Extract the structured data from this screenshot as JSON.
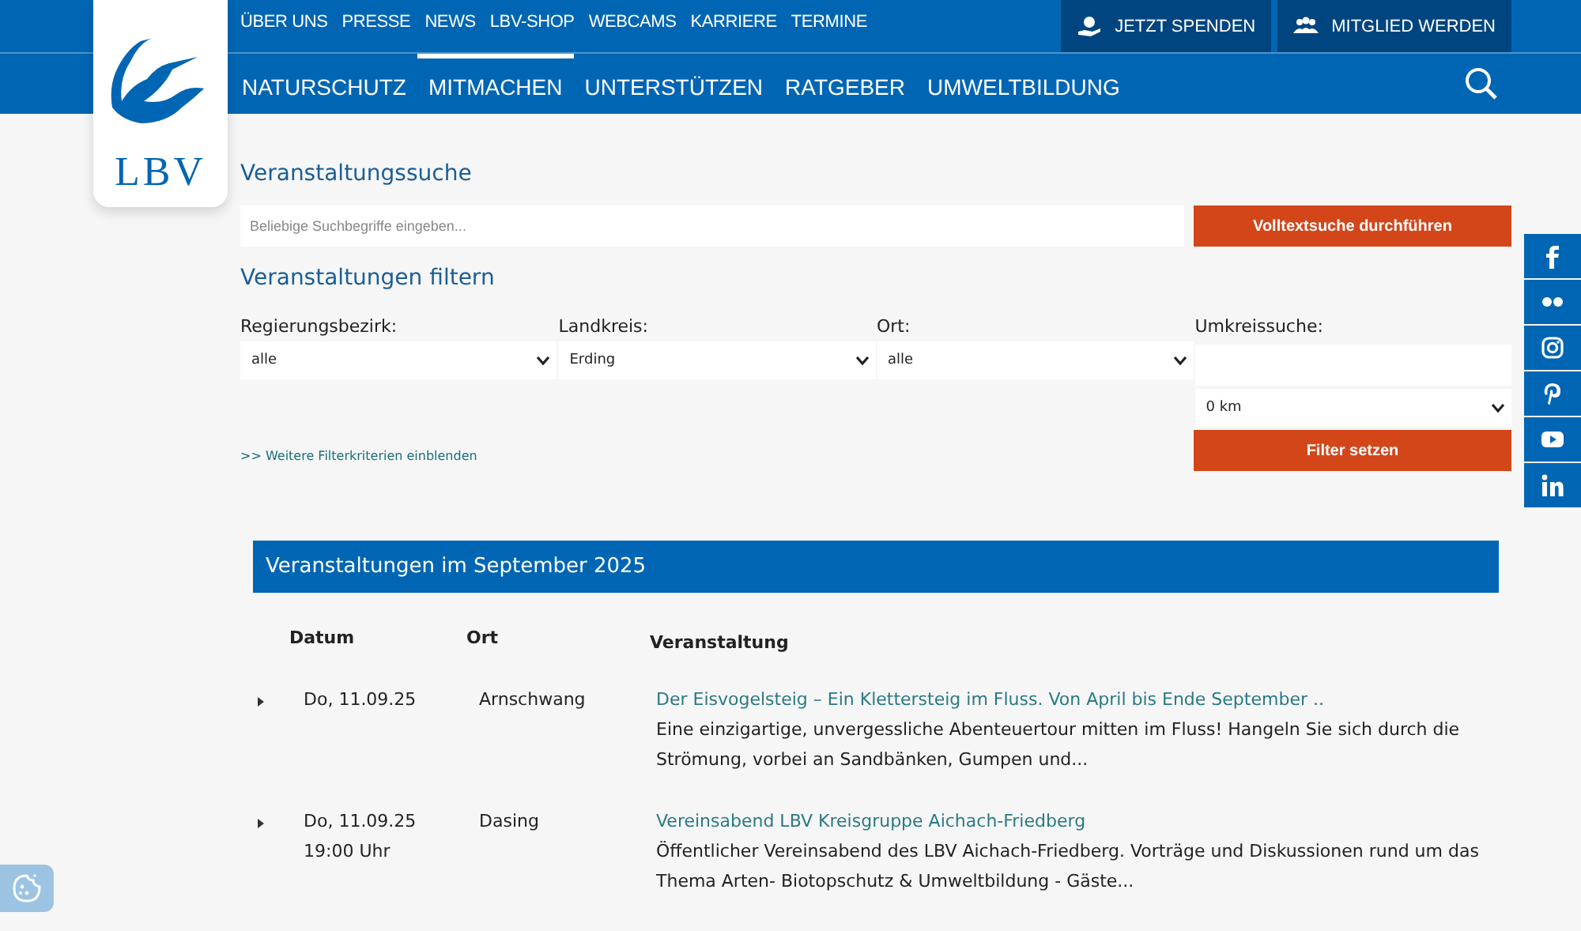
{
  "top_links": [
    {
      "label": "ÜBER UNS"
    },
    {
      "label": "PRESSE"
    },
    {
      "label": "NEWS"
    },
    {
      "label": "LBV-SHOP"
    },
    {
      "label": "WEBCAMS"
    },
    {
      "label": "KARRIERE"
    },
    {
      "label": "TERMINE"
    }
  ],
  "action_buttons": [
    {
      "kind": "donate",
      "label": "JETZT SPENDEN"
    },
    {
      "kind": "member",
      "label": "MITGLIED WERDEN"
    }
  ],
  "logo": {
    "text": "LBV"
  },
  "main_nav": [
    {
      "label": "NATURSCHUTZ",
      "selected": false
    },
    {
      "label": "MITMACHEN",
      "selected": true
    },
    {
      "label": "UNTERSTÜTZEN",
      "selected": false
    },
    {
      "label": "RATGEBER",
      "selected": false
    },
    {
      "label": "UMWELTBILDUNG",
      "selected": false
    }
  ],
  "search": {
    "title": "Veranstaltungssuche",
    "placeholder": "Beliebige Suchbegriffe eingeben...",
    "button": "Volltextsuche durchführen"
  },
  "filter": {
    "title": "Veranstaltungen filtern",
    "fields": [
      {
        "label": "Regierungsbezirk:",
        "value": "alle"
      },
      {
        "label": "Landkreis:",
        "value": "Erding"
      },
      {
        "label": "Ort:",
        "value": "alle"
      }
    ],
    "radius": {
      "label": "Umkreissuche:",
      "distance": "0 km"
    },
    "more_link": ">> Weitere Filterkriterien einblenden",
    "button": "Filter setzen"
  },
  "social": [
    {
      "kind": "facebook"
    },
    {
      "kind": "flickr"
    },
    {
      "kind": "instagram"
    },
    {
      "kind": "pinterest"
    },
    {
      "kind": "youtube"
    },
    {
      "kind": "linkedin"
    }
  ],
  "events": {
    "title": "Veranstaltungen im September 2025",
    "columns": [
      "Datum",
      "Ort",
      "Veranstaltung"
    ],
    "rows": [
      {
        "date": "Do, 11.09.25",
        "place": "Arnschwang",
        "title": "Der Eisvogelsteig – Ein Klettersteig im Fluss. Von April bis Ende September ..",
        "description": "Eine einzigartige, unvergessliche Abenteuertour mitten im Fluss! Hangeln Sie sich durch die Strömung, vorbei an Sandbänken, Gumpen und..."
      },
      {
        "date": "Do, 11.09.25",
        "time": "19:00 Uhr",
        "place": "Dasing",
        "title": "Vereinsabend LBV Kreisgruppe Aichach-Friedberg",
        "description": "Öffentlicher Vereinsabend des LBV Aichach-Friedberg. Vorträge und Diskussionen rund um das Thema Arten- Biotopschutz & Umweltbildung - Gäste..."
      }
    ]
  }
}
